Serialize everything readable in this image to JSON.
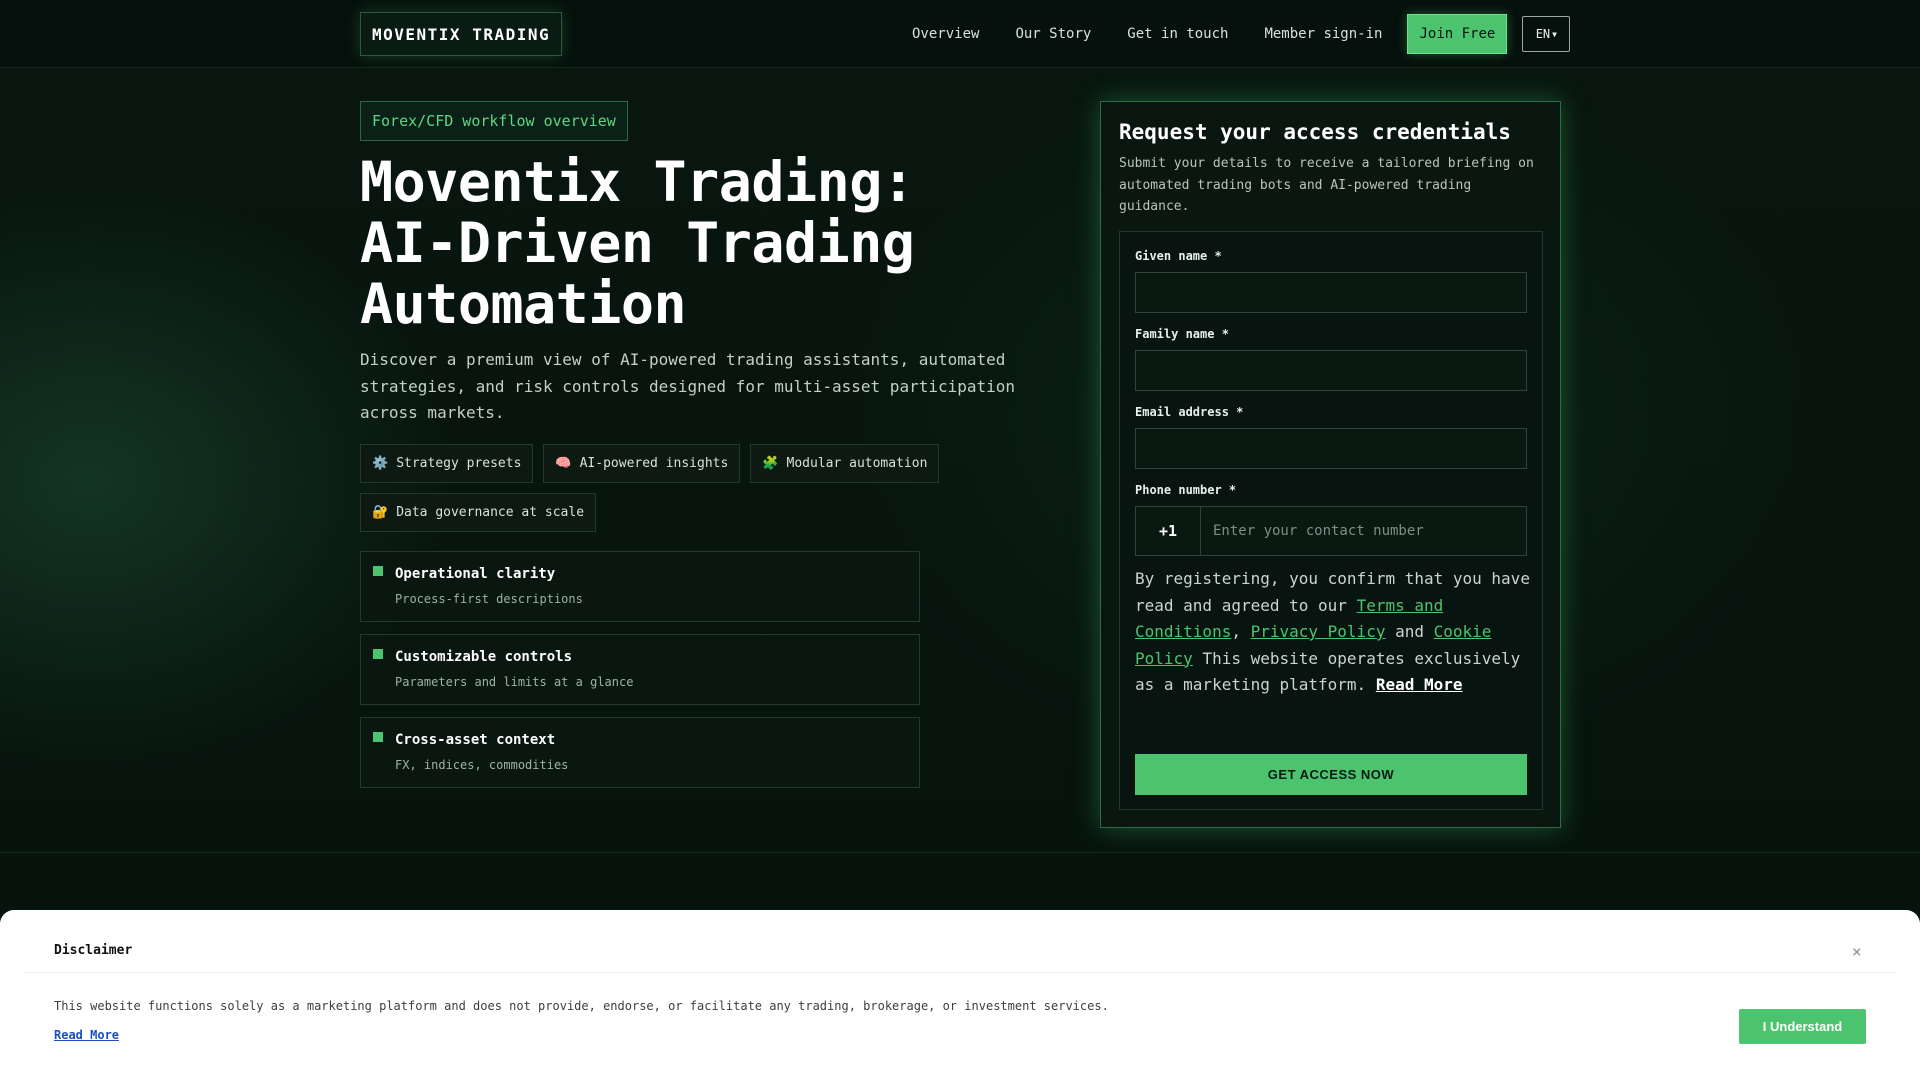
{
  "brand": {
    "name": "MOVENTIX TRADING"
  },
  "nav": {
    "links": [
      "Overview",
      "Our Story",
      "Get in touch",
      "Member sign-in"
    ],
    "join_label": "Join Free",
    "lang_label": "EN"
  },
  "hero": {
    "badge": "Forex/CFD workflow overview",
    "title_lines": [
      "Moventix Trading:",
      "AI-Driven Trading",
      "Automation"
    ],
    "description": "Discover a premium view of AI-powered trading assistants, automated strategies, and risk controls designed for multi-asset participation across markets.",
    "chips": [
      {
        "icon": "gear-icon",
        "glyph": "⚙️",
        "label": "Strategy presets"
      },
      {
        "icon": "brain-icon",
        "glyph": "🧠",
        "label": "AI-powered insights"
      },
      {
        "icon": "puzzle-icon",
        "glyph": "🧩",
        "label": "Modular automation"
      },
      {
        "icon": "lock-icon",
        "glyph": "🔐",
        "label": "Data governance at scale"
      }
    ],
    "features": [
      {
        "title": "Operational clarity",
        "subtitle": "Process-first descriptions"
      },
      {
        "title": "Customizable controls",
        "subtitle": "Parameters and limits at a glance"
      },
      {
        "title": "Cross-asset context",
        "subtitle": "FX, indices, commodities"
      }
    ]
  },
  "form": {
    "title": "Request your access credentials",
    "subtitle": "Submit your details to receive a tailored briefing on automated trading bots and AI-powered trading guidance.",
    "given_name_label": "Given name *",
    "family_name_label": "Family name *",
    "email_label": "Email address *",
    "phone_label": "Phone number *",
    "phone_code": "+1",
    "phone_placeholder": "Enter your contact number",
    "consent_prefix": "By registering, you confirm that you have read and agreed to our ",
    "terms_link": "Terms and Conditions",
    "sep_comma": ", ",
    "privacy_link": "Privacy Policy",
    "sep_and": " and ",
    "cookie_link": "Cookie Policy",
    "consent_suffix": " This website operates exclusively as a marketing platform. ",
    "read_more": "Read More",
    "submit_label": "GET ACCESS NOW"
  },
  "disclaimer": {
    "title": "Disclaimer",
    "close": "×",
    "text": "This website functions solely as a marketing platform and does not provide, endorse, or facilitate any trading, brokerage, or investment services.",
    "read_more": "Read More",
    "button": "I Understand"
  },
  "colors": {
    "accent": "#4cc46f",
    "background": "#07140f",
    "link": "#1a4fc0"
  }
}
